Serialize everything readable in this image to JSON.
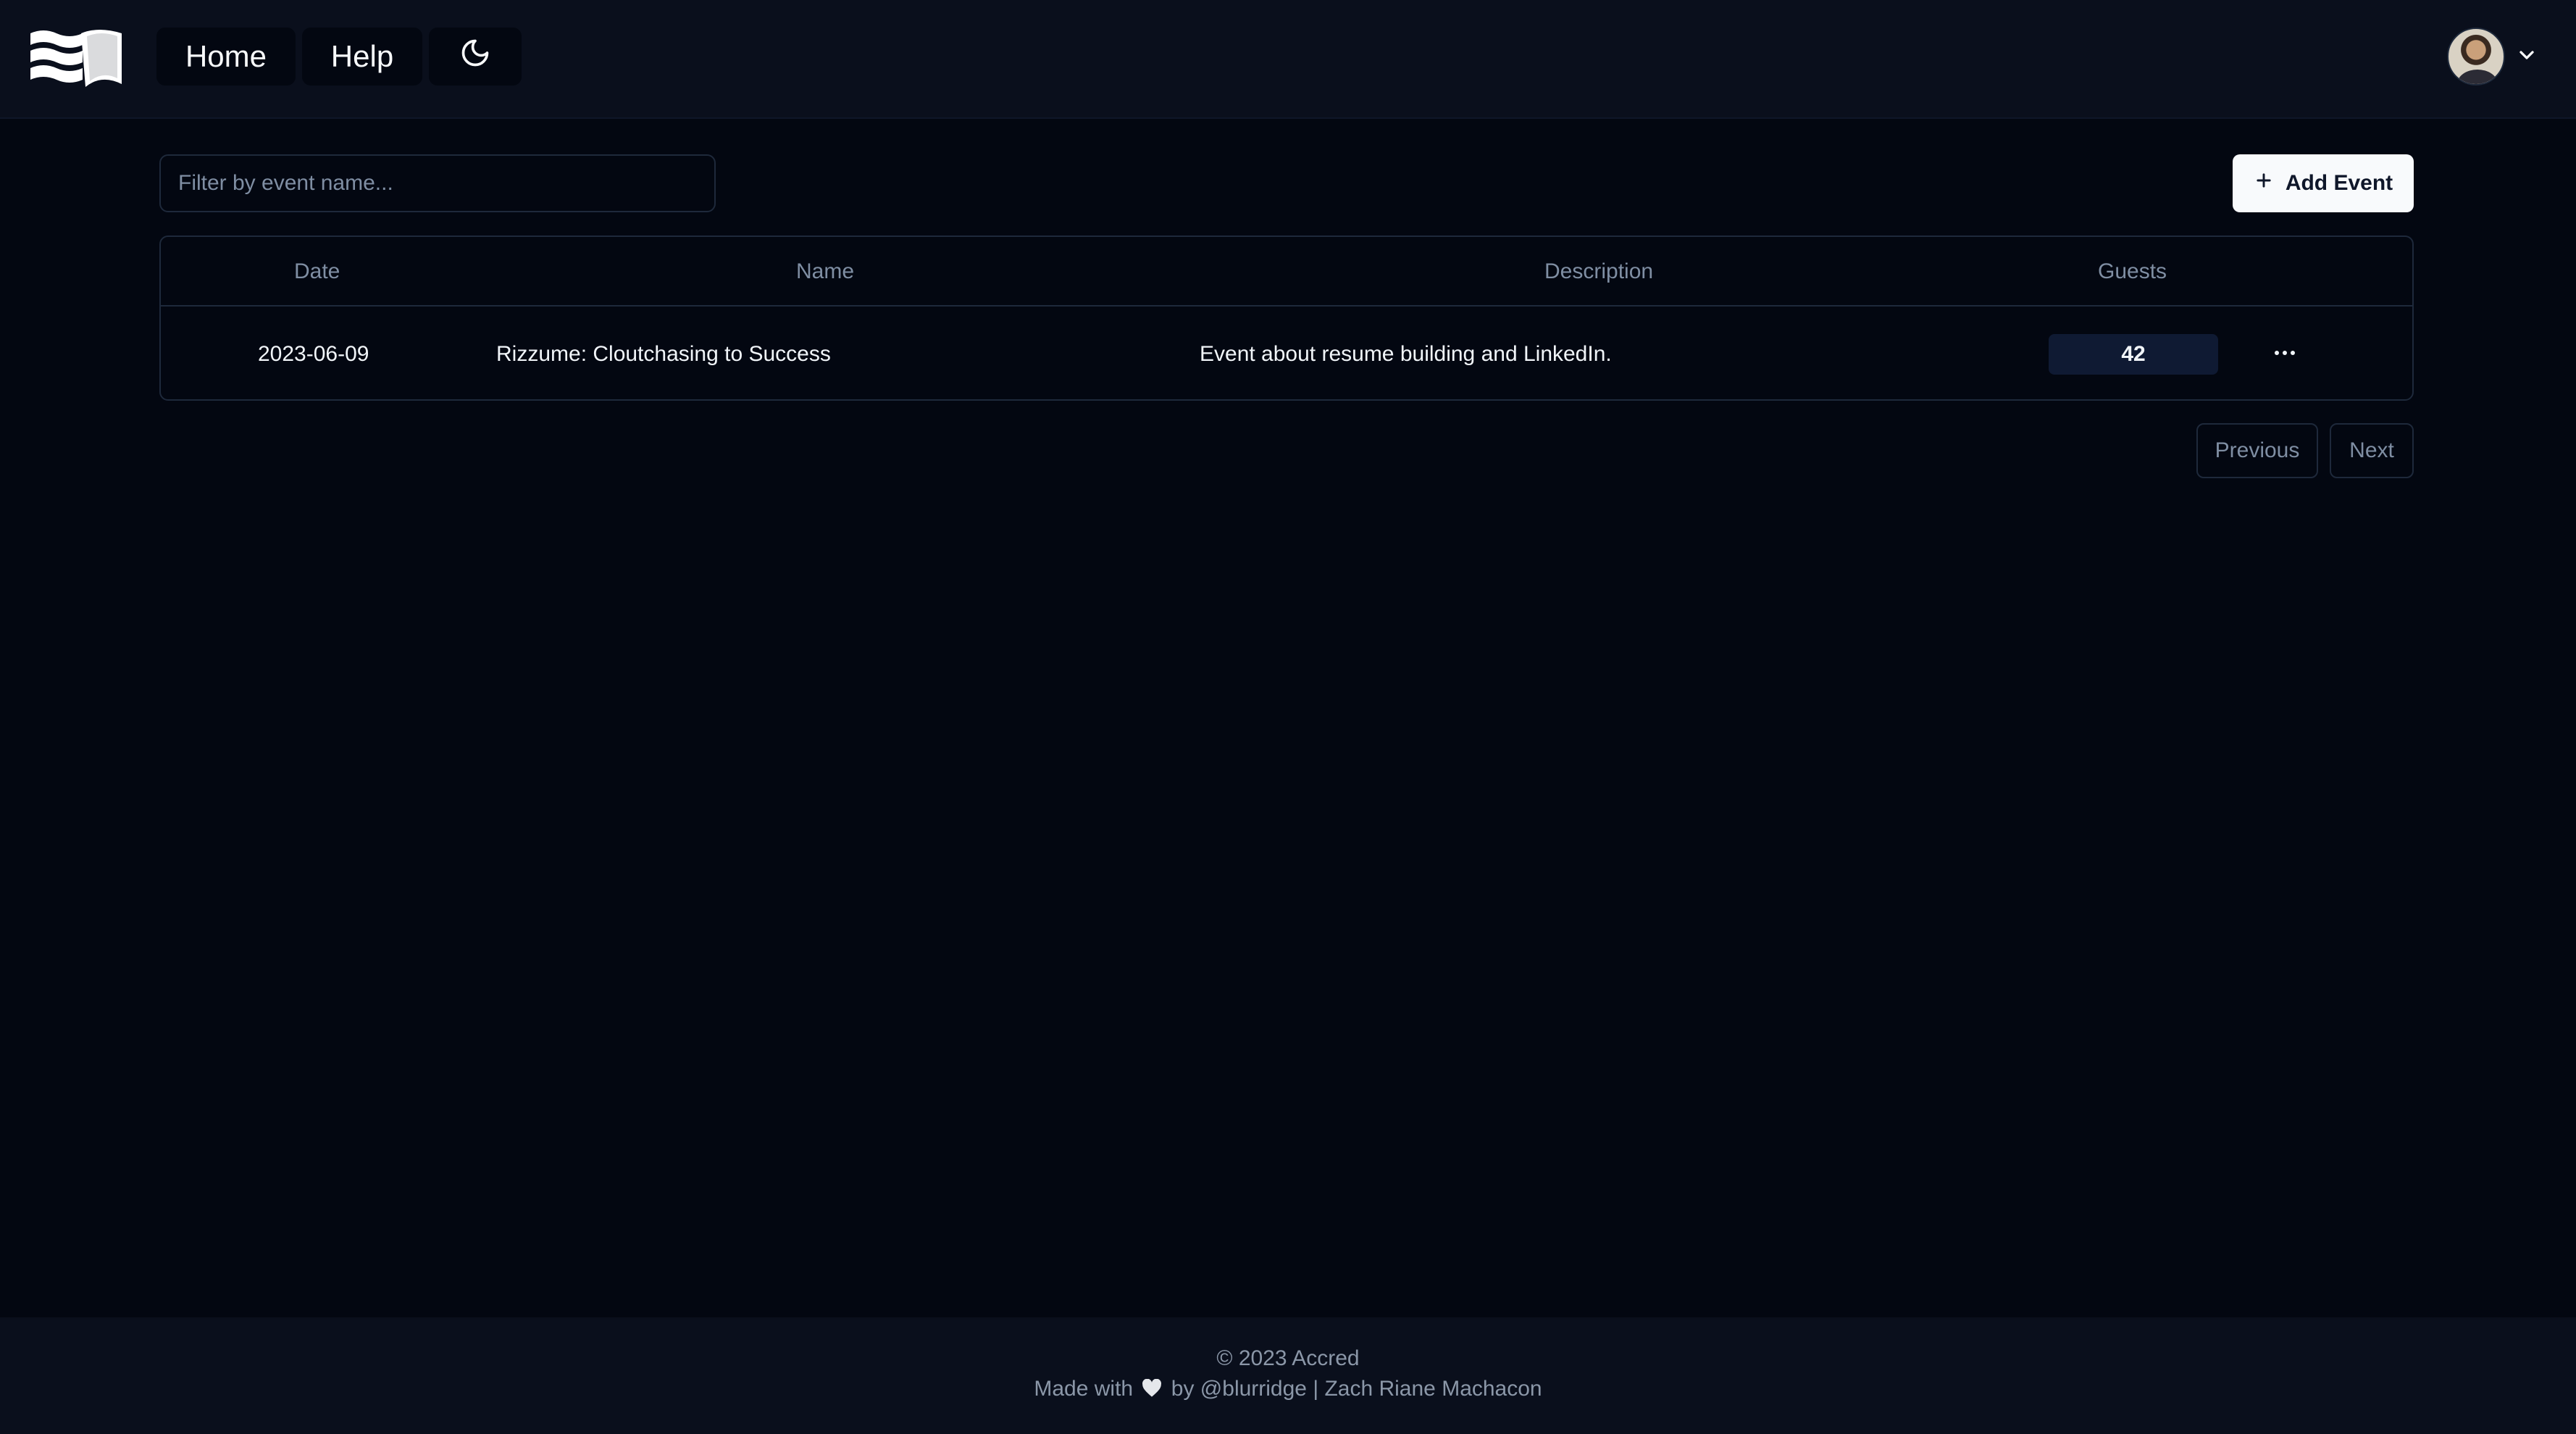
{
  "header": {
    "logo_icon": "book-waves-logo",
    "nav": {
      "home_label": "Home",
      "help_label": "Help",
      "theme_icon": "moon-icon"
    },
    "user": {
      "avatar_icon": "user-avatar",
      "menu_icon": "chevron-down-icon"
    }
  },
  "toolbar": {
    "filter_placeholder": "Filter by event name...",
    "filter_value": "",
    "add_label": "Add Event",
    "add_icon": "plus-icon"
  },
  "table": {
    "columns": [
      "Date",
      "Name",
      "Description",
      "Guests"
    ],
    "rows": [
      {
        "date": "2023-06-09",
        "name": "Rizzume: Cloutchasing to Success",
        "description": "Event about resume building and LinkedIn.",
        "guests": "42",
        "actions_icon": "more-horizontal-icon"
      }
    ]
  },
  "pagination": {
    "previous_label": "Previous",
    "next_label": "Next"
  },
  "footer": {
    "copyright": "© 2023 Accred",
    "made_with_prefix": "Made with",
    "made_with_suffix": "by @blurridge | Zach Riane Machacon",
    "heart_icon": "heart-icon"
  },
  "colors": {
    "background": "#030711",
    "header_bg": "#0a0f1c",
    "border": "#1e293b",
    "muted_text": "#7f8ea3",
    "primary_button": "#f8fafc",
    "badge_bg": "#0f1a33"
  }
}
